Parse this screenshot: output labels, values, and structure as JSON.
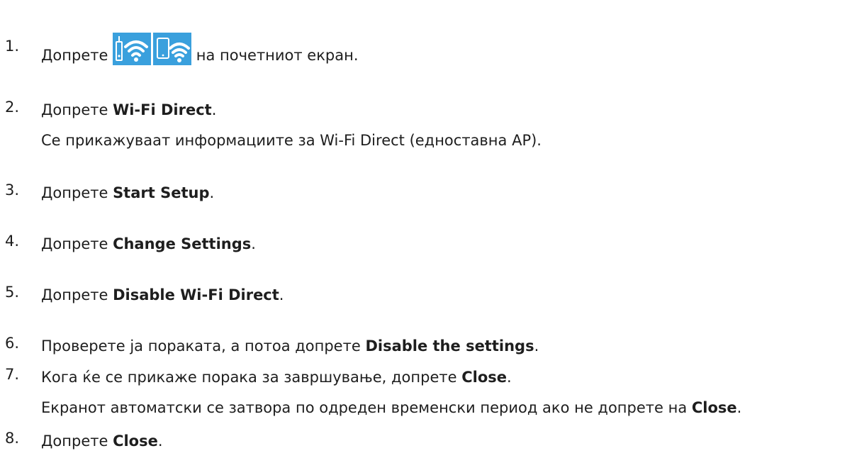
{
  "steps": [
    {
      "num": "1.",
      "pre": "Допрете",
      "bold": "",
      "post": "на почетниот екран.",
      "sub_pre": "",
      "sub_bold": "",
      "sub_post": ""
    },
    {
      "num": "2.",
      "pre": "Допрете ",
      "bold": "Wi-Fi Direct",
      "post": ".",
      "sub_pre": "Се прикажуваат информациите за Wi-Fi Direct (едноставна AP).",
      "sub_bold": "",
      "sub_post": ""
    },
    {
      "num": "3.",
      "pre": "Допрете ",
      "bold": "Start Setup",
      "post": ".",
      "sub_pre": "",
      "sub_bold": "",
      "sub_post": ""
    },
    {
      "num": "4.",
      "pre": "Допрете ",
      "bold": "Change Settings",
      "post": ".",
      "sub_pre": "",
      "sub_bold": "",
      "sub_post": ""
    },
    {
      "num": "5.",
      "pre": "Допрете ",
      "bold": "Disable Wi-Fi Direct",
      "post": ".",
      "sub_pre": "",
      "sub_bold": "",
      "sub_post": ""
    },
    {
      "num": "6.",
      "pre": "Проверете ја пораката, а потоа допрете ",
      "bold": "Disable the settings",
      "post": ".",
      "sub_pre": "",
      "sub_bold": "",
      "sub_post": ""
    },
    {
      "num": "7.",
      "pre": "Кога ќе се прикаже порака за завршување, допрете ",
      "bold": "Close",
      "post": ".",
      "sub_pre": "Екранот автоматски се затвора по одреден временски период ако не допрете на ",
      "sub_bold": "Close",
      "sub_post": "."
    },
    {
      "num": "8.",
      "pre": "Допрете ",
      "bold": "Close",
      "post": ".",
      "sub_pre": "",
      "sub_bold": "",
      "sub_post": ""
    }
  ],
  "icons": {
    "first": "wifi-router-icon",
    "second": "wifi-direct-device-icon",
    "color": "#3aa0dd"
  }
}
